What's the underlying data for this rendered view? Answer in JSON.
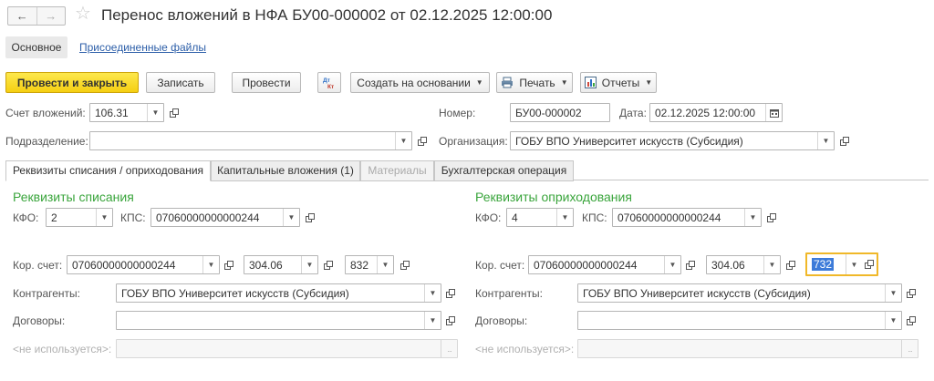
{
  "window": {
    "title": "Перенос вложений в НФА БУ00-000002 от 02.12.2025 12:00:00"
  },
  "sections": {
    "main": "Основное",
    "attached": "Присоединенные файлы"
  },
  "toolbar": {
    "post_close": "Провести и закрыть",
    "save": "Записать",
    "post": "Провести",
    "dtkt": "Дт Кт",
    "create_based": "Создать на основании",
    "print": "Печать",
    "reports": "Отчеты"
  },
  "header": {
    "account_label": "Счет вложений:",
    "account_value": "106.31",
    "number_label": "Номер:",
    "number_value": "БУ00-000002",
    "date_label": "Дата:",
    "date_value": "02.12.2025 12:00:00",
    "division_label": "Подразделение:",
    "division_value": "",
    "org_label": "Организация:",
    "org_value": "ГОБУ ВПО Университет искусств (Субсидия)"
  },
  "tabs": [
    {
      "label": "Реквизиты списания / оприходования",
      "active": true
    },
    {
      "label": "Капитальные вложения (1)",
      "active": false
    },
    {
      "label": "Материалы",
      "active": false,
      "disabled": true
    },
    {
      "label": "Бухгалтерская операция",
      "active": false
    }
  ],
  "writeoff": {
    "heading": "Реквизиты списания",
    "kfo_label": "КФО:",
    "kfo_value": "2",
    "kps_label": "КПС:",
    "kps_value": "07060000000000244",
    "corr_label": "Кор. счет:",
    "corr_kps": "07060000000000244",
    "corr_account": "304.06",
    "corr_kosgu": "832",
    "contractors_label": "Контрагенты:",
    "contractors_value": "ГОБУ ВПО Университет искусств (Субсидия)",
    "contracts_label": "Договоры:",
    "contracts_value": "",
    "unused_label": "<не используется>:",
    "unused_value": ""
  },
  "receipt": {
    "heading": "Реквизиты оприходования",
    "kfo_label": "КФО:",
    "kfo_value": "4",
    "kps_label": "КПС:",
    "kps_value": "07060000000000244",
    "corr_label": "Кор. счет:",
    "corr_kps": "07060000000000244",
    "corr_account": "304.06",
    "corr_kosgu": "732",
    "contractors_label": "Контрагенты:",
    "contractors_value": "ГОБУ ВПО Университет искусств (Субсидия)",
    "contracts_label": "Договоры:",
    "contracts_value": "",
    "unused_label": "<не используется>:",
    "unused_value": ""
  }
}
